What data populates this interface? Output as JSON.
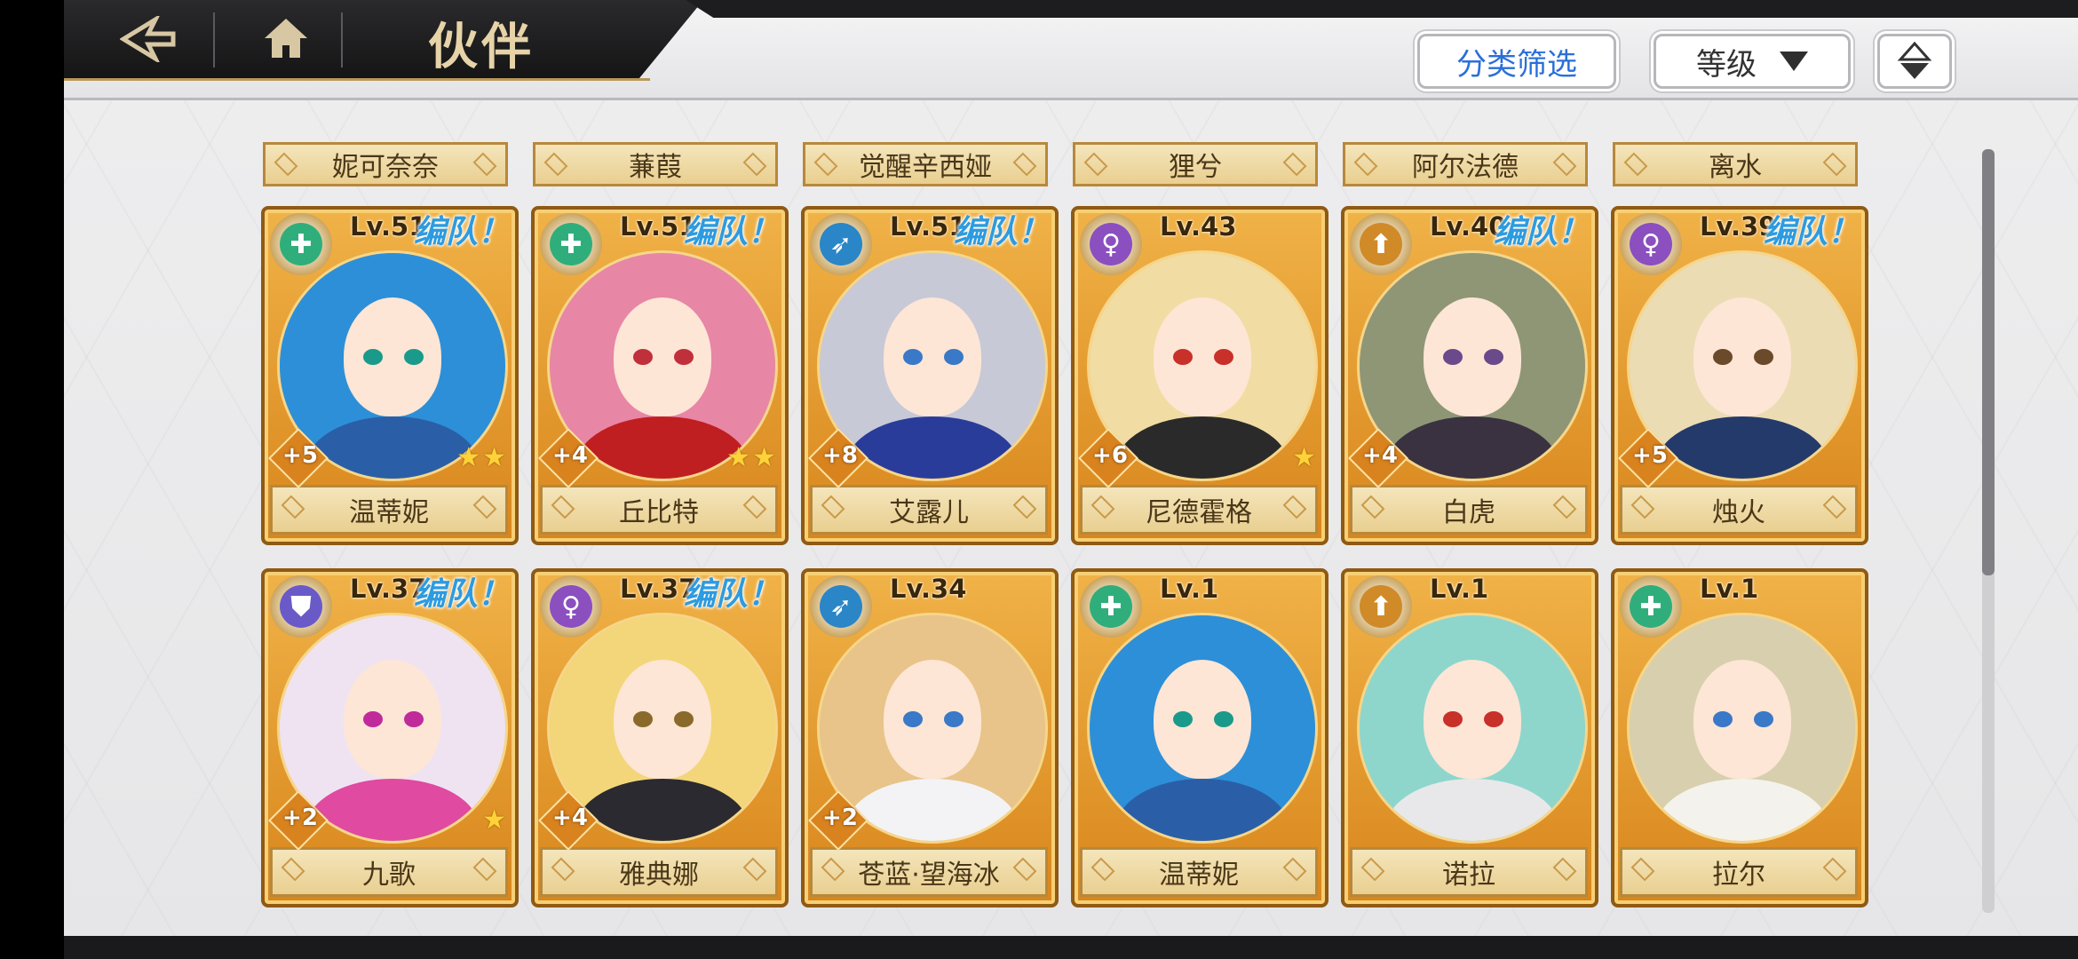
{
  "header": {
    "title": "伙伴",
    "filter_label": "分类筛选",
    "sort_label": "等级"
  },
  "top_partial_names": [
    "妮可奈奈",
    "蒹葭",
    "觉醒辛西娅",
    "狸兮",
    "阿尔法德",
    "离水"
  ],
  "cards": [
    {
      "name": "温蒂妮",
      "level": "Lv.51",
      "team": "编队！",
      "plus": "+5",
      "stars": 2,
      "class_icon": "cross-icon",
      "class_color": "#2fae7c",
      "hair": "#2d8fd8",
      "eye": "#1a9a8a",
      "outfit": "#2a5fa8"
    },
    {
      "name": "丘比特",
      "level": "Lv.51",
      "team": "编队！",
      "plus": "+4",
      "stars": 2,
      "class_icon": "cross-icon",
      "class_color": "#2fae7c",
      "hair": "#e886a6",
      "eye": "#c0303a",
      "outfit": "#c01f22"
    },
    {
      "name": "艾露儿",
      "level": "Lv.51",
      "team": "编队！",
      "plus": "+8",
      "stars": 0,
      "class_icon": "bow-icon",
      "class_color": "#2a86c6",
      "hair": "#c8c9d6",
      "eye": "#3a78c8",
      "outfit": "#2a3c9a"
    },
    {
      "name": "尼德霍格",
      "level": "Lv.43",
      "team": "",
      "plus": "+6",
      "stars": 1,
      "class_icon": "venus-icon",
      "class_color": "#8b4fbf",
      "hair": "#f1dca4",
      "eye": "#c8302a",
      "outfit": "#2a2a2a"
    },
    {
      "name": "白虎",
      "level": "Lv.40",
      "team": "编队！",
      "plus": "+4",
      "stars": 0,
      "class_icon": "sword-icon",
      "class_color": "#d08a28",
      "hair": "#8e9676",
      "eye": "#6a4a8a",
      "outfit": "#3a3240"
    },
    {
      "name": "烛火",
      "level": "Lv.39",
      "team": "编队！",
      "plus": "+5",
      "stars": 0,
      "class_icon": "venus-icon",
      "class_color": "#8b4fbf",
      "hair": "#ecdcb4",
      "eye": "#6a4a2a",
      "outfit": "#243a6a"
    },
    {
      "name": "九歌",
      "level": "Lv.37",
      "team": "编队！",
      "plus": "+2",
      "stars": 1,
      "class_icon": "shield-icon",
      "class_color": "#6a5ac8",
      "hair": "#efe3f2",
      "eye": "#c02a9a",
      "outfit": "#e04aa0"
    },
    {
      "name": "雅典娜",
      "level": "Lv.37",
      "team": "编队！",
      "plus": "+4",
      "stars": 0,
      "class_icon": "venus-icon",
      "class_color": "#8b4fbf",
      "hair": "#f3d67a",
      "eye": "#8a6a2a",
      "outfit": "#2a2a30"
    },
    {
      "name": "苍蓝·望海冰",
      "level": "Lv.34",
      "team": "",
      "plus": "+2",
      "stars": 0,
      "class_icon": "bow-icon",
      "class_color": "#2a86c6",
      "hair": "#e8c48a",
      "eye": "#3a78c8",
      "outfit": "#f3f3f6"
    },
    {
      "name": "温蒂妮",
      "level": "Lv.1",
      "team": "",
      "plus": "",
      "stars": 0,
      "class_icon": "cross-icon",
      "class_color": "#2fae7c",
      "hair": "#2d8fd8",
      "eye": "#1a9a8a",
      "outfit": "#2a5fa8"
    },
    {
      "name": "诺拉",
      "level": "Lv.1",
      "team": "",
      "plus": "",
      "stars": 0,
      "class_icon": "sword-icon",
      "class_color": "#d08a28",
      "hair": "#8ed6cc",
      "eye": "#c8302a",
      "outfit": "#e8e8ea"
    },
    {
      "name": "拉尔",
      "level": "Lv.1",
      "team": "",
      "plus": "",
      "stars": 0,
      "class_icon": "cross-icon",
      "class_color": "#2fae7c",
      "hair": "#d8cfae",
      "eye": "#3a78c8",
      "outfit": "#f4f2ec"
    }
  ]
}
